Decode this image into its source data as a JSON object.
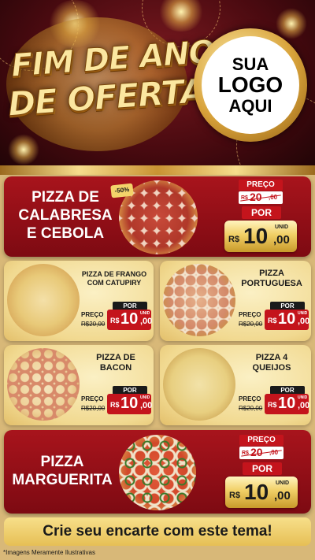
{
  "header": {
    "title_line1": "FIM DE ANO",
    "title_line2": "DE OFERTAS",
    "logo_line1": "SUA",
    "logo_line2": "LOGO",
    "logo_line3": "AQUI"
  },
  "featured_top": {
    "name_line1": "PIZZA DE",
    "name_line2": "CALABRESA",
    "name_line3": "E CEBOLA",
    "discount": "-50%",
    "preco_label": "PREÇO",
    "old_currency": "R$",
    "old_int": "20",
    "old_dec": ",00",
    "por_label": "POR",
    "currency": "R$",
    "price_int": "10",
    "price_dec": ",00",
    "unit": "UNID"
  },
  "grid_items": [
    {
      "name_line1": "PIZZA DE FRANGO",
      "name_line2": "COM CATUPIRY",
      "preco_label": "PREÇO",
      "old_price": "R$20,00",
      "por_label": "POR",
      "currency": "R$",
      "price_int": "10",
      "price_dec": ",00",
      "unit": "UNID"
    },
    {
      "name_line1": "PIZZA",
      "name_line2": "PORTUGUESA",
      "preco_label": "PREÇO",
      "old_price": "R$20,00",
      "por_label": "POR",
      "currency": "R$",
      "price_int": "10",
      "price_dec": ",00",
      "unit": "UNID"
    },
    {
      "name_line1": "PIZZA DE",
      "name_line2": "BACON",
      "preco_label": "PREÇO",
      "old_price": "R$20,00",
      "por_label": "POR",
      "currency": "R$",
      "price_int": "10",
      "price_dec": ",00",
      "unit": "UNID"
    },
    {
      "name_line1": "PIZZA 4",
      "name_line2": "QUEIJOS",
      "preco_label": "PREÇO",
      "old_price": "R$20,00",
      "por_label": "POR",
      "currency": "R$",
      "price_int": "10",
      "price_dec": ",00",
      "unit": "UNID"
    }
  ],
  "featured_bottom": {
    "name_line1": "PIZZA",
    "name_line2": "MARGUERITA",
    "preco_label": "PREÇO",
    "old_currency": "R$",
    "old_int": "20",
    "old_dec": ",00",
    "por_label": "POR",
    "currency": "R$",
    "price_int": "10",
    "price_dec": ",00",
    "unit": "UNID"
  },
  "footer": {
    "cta": "Crie seu encarte com este tema!",
    "disclaimer": "*Imagens Meramente Ilustrativas"
  },
  "colors": {
    "brand_red": "#c4141c",
    "header_bg": "#4a0a10",
    "gold": "#f1cf66",
    "cream": "#f1d990"
  }
}
